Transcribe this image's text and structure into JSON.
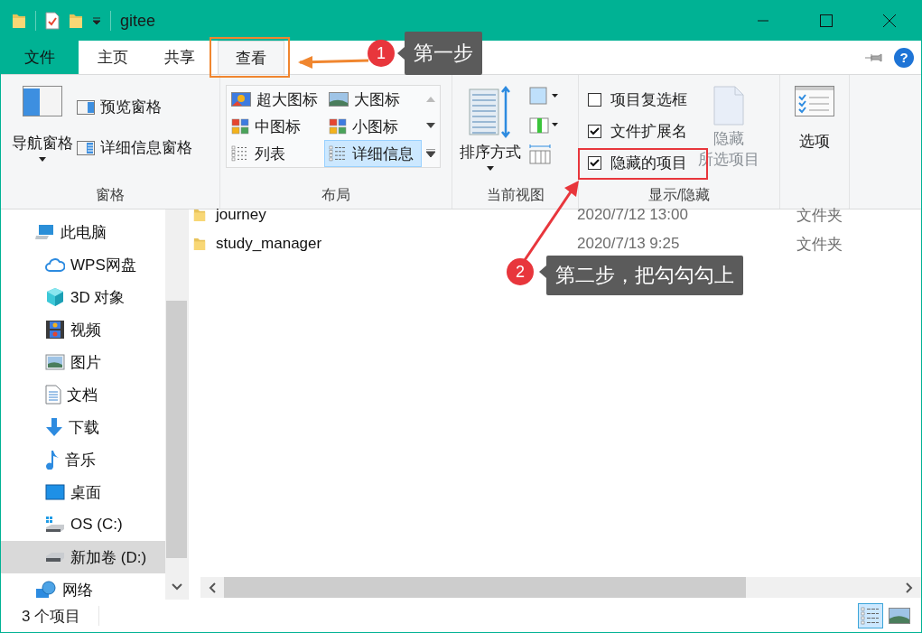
{
  "window": {
    "title": "gitee"
  },
  "tabs": [
    {
      "label": "文件",
      "kind": "file",
      "selected": false
    },
    {
      "label": "主页",
      "kind": "tab",
      "selected": false
    },
    {
      "label": "共享",
      "kind": "tab",
      "selected": false
    },
    {
      "label": "查看",
      "kind": "tab",
      "selected": true
    }
  ],
  "help": "?",
  "ribbon": {
    "panes": {
      "label": "窗格",
      "navigation": "导航窗格",
      "buttons": [
        "预览窗格",
        "详细信息窗格"
      ]
    },
    "layout": {
      "label": "布局",
      "items": [
        {
          "label": "超大图标",
          "selected": false
        },
        {
          "label": "大图标",
          "selected": false
        },
        {
          "label": "中图标",
          "selected": false
        },
        {
          "label": "小图标",
          "selected": false
        },
        {
          "label": "列表",
          "selected": false
        },
        {
          "label": "详细信息",
          "selected": true
        }
      ]
    },
    "current_view": {
      "label": "当前视图",
      "sort": "排序方式"
    },
    "show_hide": {
      "label": "显示/隐藏",
      "checkboxes": [
        {
          "label": "项目复选框",
          "checked": false
        },
        {
          "label": "文件扩展名",
          "checked": true
        },
        {
          "label": "隐藏的项目",
          "checked": true
        }
      ],
      "hide_selected": {
        "lines": [
          "隐藏",
          "所选项目"
        ],
        "disabled": true
      }
    },
    "options": {
      "label": "选项"
    }
  },
  "nav": [
    {
      "label": "此电脑",
      "selected": false,
      "children": [
        {
          "label": "WPS网盘",
          "selected": false
        },
        {
          "label": "3D 对象",
          "selected": false
        },
        {
          "label": "视频",
          "selected": false
        },
        {
          "label": "图片",
          "selected": false
        },
        {
          "label": "文档",
          "selected": false
        },
        {
          "label": "下载",
          "selected": false
        },
        {
          "label": "音乐",
          "selected": false
        },
        {
          "label": "桌面",
          "selected": false
        },
        {
          "label": "OS (C:)",
          "selected": false
        },
        {
          "label": "新加卷 (D:)",
          "selected": true
        }
      ]
    },
    {
      "label": "网络",
      "selected": false
    }
  ],
  "files": [
    {
      "name": "journey",
      "date": "2020/7/12 13:00",
      "type": "文件夹"
    },
    {
      "name": "study_manager",
      "date": "2020/7/13 9:25",
      "type": "文件夹"
    }
  ],
  "status_bar": {
    "count": "3 个项目",
    "views": [
      {
        "kind": "details",
        "selected": true
      },
      {
        "kind": "large",
        "selected": false
      }
    ]
  },
  "annotations": [
    {
      "number": "1",
      "text": "第一步",
      "color": "#f0862f"
    },
    {
      "number": "2",
      "text": "第二步，把勾勾勾上",
      "color": "#e8363c"
    }
  ]
}
